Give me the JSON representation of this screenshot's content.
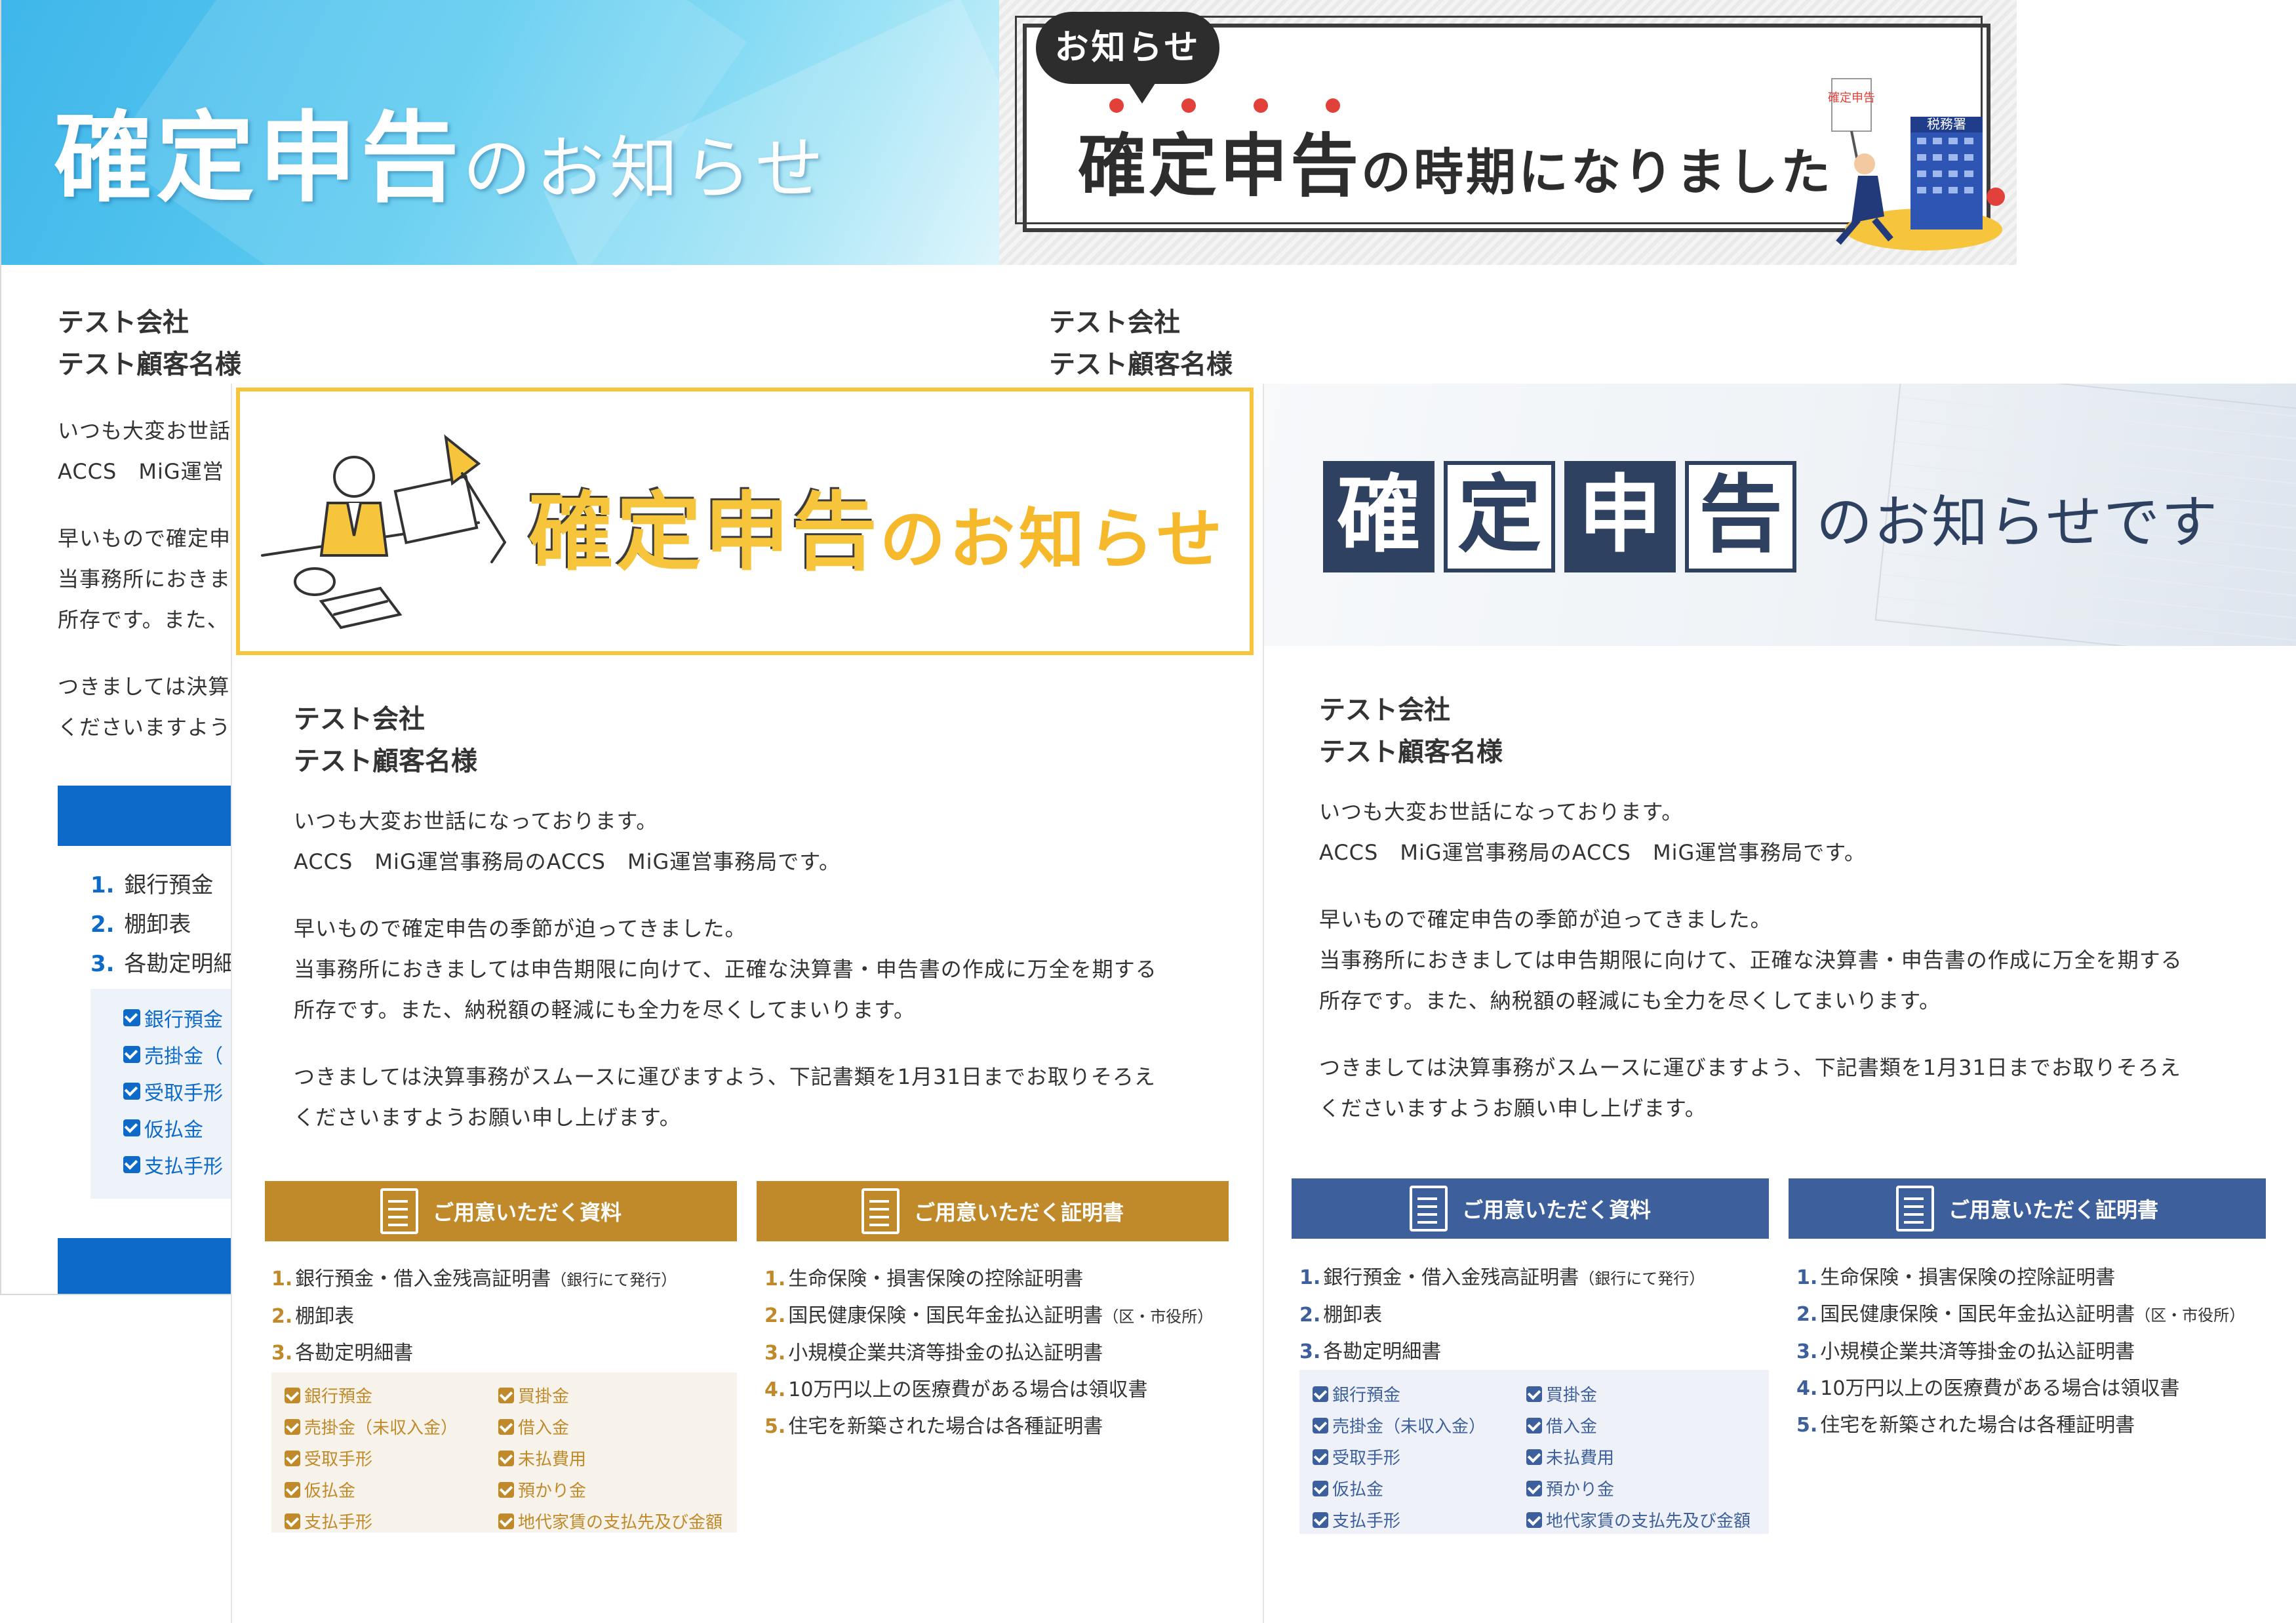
{
  "palette": {
    "gold": "#c08a2a",
    "navy": "#3d5f9b",
    "blue": "#0e6ac9",
    "yellow": "#f6c53c",
    "sky": "#3fb6ea"
  },
  "recipient": {
    "company": "テスト会社",
    "customer": "テスト顧客名様"
  },
  "card1": {
    "title_main": "確定申告",
    "title_suffix": "のお知らせ",
    "body_fragments": [
      "いつも大変お世話",
      "ACCS　MiG運営",
      "早いもので確定申",
      "当事務所におきま",
      "所存です。また、",
      "つきましては決算",
      "くださいますよう"
    ],
    "list": [
      {
        "num": "1.",
        "text": "銀行預金"
      },
      {
        "num": "2.",
        "text": "棚卸表"
      },
      {
        "num": "3.",
        "text": "各勘定明細"
      }
    ],
    "checks": [
      "銀行預金",
      "売掛金（",
      "受取手形",
      "仮払金",
      "支払手形"
    ]
  },
  "card2": {
    "bubble": "お知らせ",
    "title_main": "確定申告",
    "title_suffix": "の時期になりました",
    "sign": "確定申告",
    "building": "税務署"
  },
  "card3": {
    "title_main": "確定申告",
    "title_suffix": "のお知らせ"
  },
  "card4": {
    "kanji": [
      "確",
      "定",
      "申",
      "告"
    ],
    "title_suffix": "のお知らせです"
  },
  "letter": {
    "greeting": "いつも大変お世話になっております。",
    "intro": "ACCS　MiG運営事務局のACCS　MiG運営事務局です。",
    "para1_l1": "早いもので確定申告の季節が迫ってきました。",
    "para1_l2": "当事務所におきましては申告期限に向けて、正確な決算書・申告書の作成に万全を期する",
    "para1_l3": "所存です。また、納税額の軽減にも全力を尽くしてまいります。",
    "para2_l1": "つきましては決算事務がスムースに運びますよう、下記書類を1月31日までお取りそろえ",
    "para2_l2": "くださいますようお願い申し上げます。"
  },
  "sections": {
    "materials_title": "ご用意いただく資料",
    "certs_title": "ご用意いただく証明書",
    "materials": [
      {
        "num": "1.",
        "text": "銀行預金・借入金残高証明書",
        "note": "（銀行にて発行）"
      },
      {
        "num": "2.",
        "text": "棚卸表",
        "note": ""
      },
      {
        "num": "3.",
        "text": "各勘定明細書",
        "note": ""
      }
    ],
    "certs": [
      {
        "num": "1.",
        "text": "生命保険・損害保険の控除証明書",
        "note": ""
      },
      {
        "num": "2.",
        "text": "国民健康保険・国民年金払込証明書",
        "note": "（区・市役所）"
      },
      {
        "num": "3.",
        "text": "小規模企業共済等掛金の払込証明書",
        "note": ""
      },
      {
        "num": "4.",
        "text": "10万円以上の医療費がある場合は領収書",
        "note": ""
      },
      {
        "num": "5.",
        "text": "住宅を新築された場合は各種証明書",
        "note": ""
      }
    ],
    "checks_left": [
      "銀行預金",
      "売掛金（未収入金）",
      "受取手形",
      "仮払金",
      "支払手形"
    ],
    "checks_right": [
      "買掛金",
      "借入金",
      "未払費用",
      "預かり金",
      "地代家賃の支払先及び金額"
    ]
  }
}
